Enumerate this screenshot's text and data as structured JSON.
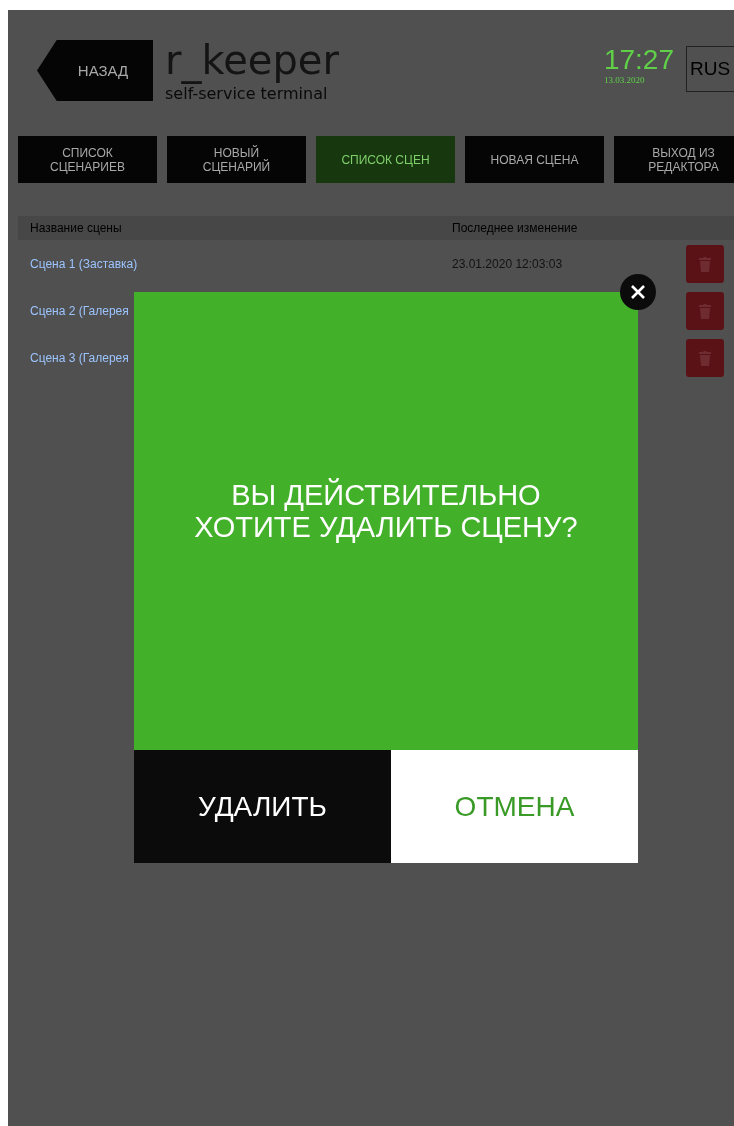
{
  "header": {
    "back_button": "НАЗАД",
    "logo": {
      "name": "r_keeper",
      "subtitle": "self-service terminal"
    },
    "time": "17:27",
    "date": "13.03.2020",
    "language": "RUS"
  },
  "tabs": [
    {
      "label": "СПИСОК\nСЦЕНАРИЕВ",
      "selected": false
    },
    {
      "label": "НОВЫЙ\nСЦЕНАРИЙ",
      "selected": false
    },
    {
      "label": "СПИСОК СЦЕН",
      "selected": true
    },
    {
      "label": "НОВАЯ СЦЕНА",
      "selected": false
    },
    {
      "label": "ВЫХОД ИЗ\nРЕДАКТОРА",
      "selected": false
    }
  ],
  "table": {
    "columns": [
      "Название сцены",
      "Последнее изменение"
    ],
    "rows": [
      {
        "name": "Сцена 1 (Заставка)",
        "modified": "23.01.2020 12:03:03"
      },
      {
        "name": "Сцена 2 (Галерея"
      },
      {
        "name": "Сцена 3 (Галерея"
      }
    ]
  },
  "dialog": {
    "message": "ВЫ ДЕЙСТВИТЕЛЬНО\nХОТИТЕ УДАЛИТЬ СЦЕНУ?",
    "buttons": [
      {
        "label": "УДАЛИТЬ",
        "kind": "confirm"
      },
      {
        "label": "ОТМЕНА",
        "kind": "cancel"
      }
    ]
  }
}
